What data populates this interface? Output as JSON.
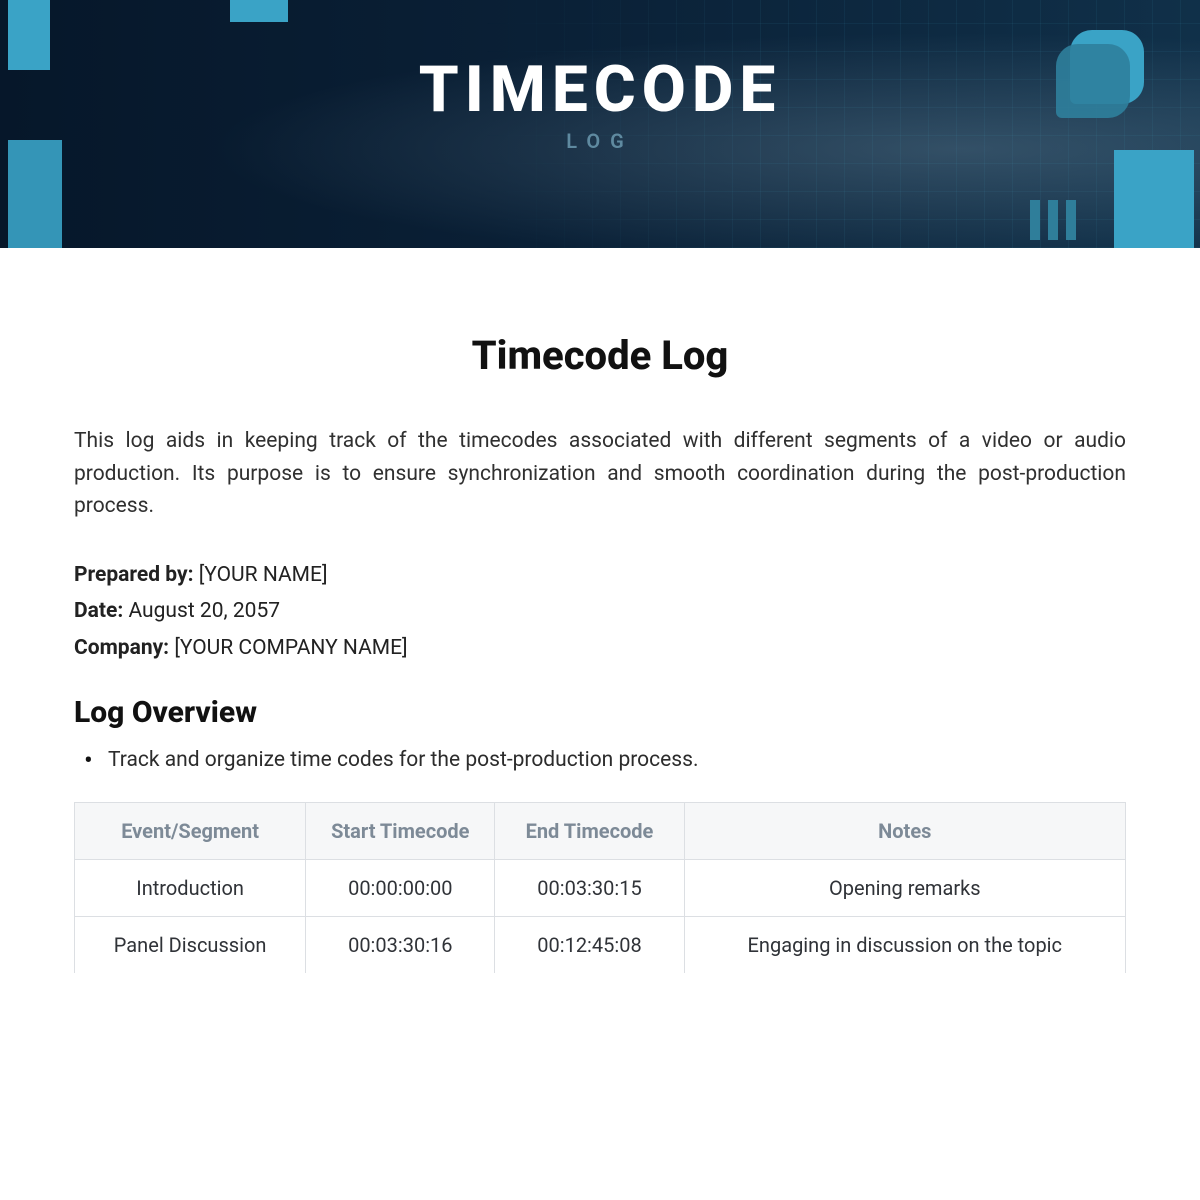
{
  "hero": {
    "title": "TIMECODE",
    "subtitle": "LOG"
  },
  "doc": {
    "title": "Timecode Log",
    "intro": "This log aids in keeping track of the timecodes associated with different segments of a video or audio production. Its purpose is to ensure synchronization and smooth coordination during the post-production process.",
    "meta": {
      "prepared_by_label": "Prepared by:",
      "prepared_by_value": "[YOUR NAME]",
      "date_label": "Date:",
      "date_value": "August 20, 2057",
      "company_label": "Company:",
      "company_value": "[YOUR COMPANY NAME]"
    },
    "overview_heading": "Log Overview",
    "overview_bullets": [
      "Track and organize time codes for the post-production process."
    ]
  },
  "table": {
    "headers": [
      "Event/Segment",
      "Start Timecode",
      "End Timecode",
      "Notes"
    ],
    "rows": [
      {
        "segment": "Introduction",
        "start": "00:00:00:00",
        "end": "00:03:30:15",
        "notes": "Opening remarks"
      },
      {
        "segment": "Panel Discussion",
        "start": "00:03:30:16",
        "end": "00:12:45:08",
        "notes": "Engaging in discussion on the topic"
      }
    ]
  }
}
